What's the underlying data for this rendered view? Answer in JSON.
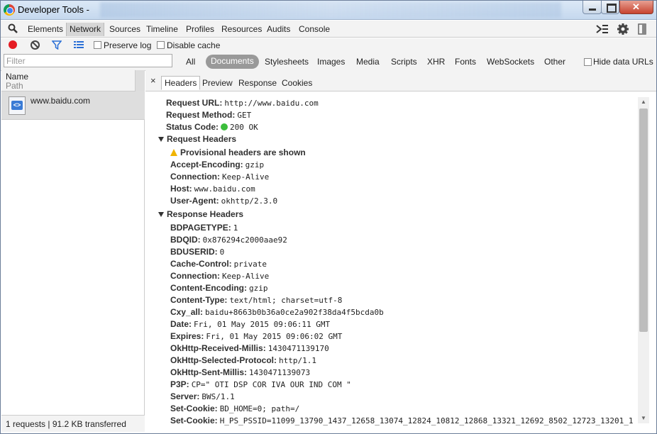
{
  "window": {
    "title": "Developer Tools -"
  },
  "toolbar": {
    "tabs": [
      "Elements",
      "Network",
      "Sources",
      "Timeline",
      "Profiles",
      "Resources",
      "Audits",
      "Console"
    ],
    "active": "Network"
  },
  "controls": {
    "preserve_log": "Preserve log",
    "disable_cache": "Disable cache"
  },
  "filter": {
    "placeholder": "Filter",
    "all": "All",
    "types": [
      "Documents",
      "Stylesheets",
      "Images",
      "Media",
      "Scripts",
      "XHR",
      "Fonts",
      "WebSockets",
      "Other"
    ],
    "active": "Documents",
    "hide_data_urls": "Hide data URLs"
  },
  "request_list": {
    "col_name": "Name",
    "col_path": "Path",
    "items": [
      {
        "name": "www.baidu.com"
      }
    ],
    "status": "1 requests | 91.2 KB transferred"
  },
  "detail": {
    "close": "×",
    "tabs": [
      "Headers",
      "Preview",
      "Response",
      "Cookies"
    ],
    "active": "Headers",
    "general": [
      {
        "k": "Request URL:",
        "v": "http://www.baidu.com"
      },
      {
        "k": "Request Method:",
        "v": "GET"
      },
      {
        "k": "Status Code:",
        "v": "200 OK"
      }
    ],
    "request_headers_title": "Request Headers",
    "provisional": "Provisional headers are shown",
    "request_headers": [
      {
        "k": "Accept-Encoding:",
        "v": "gzip"
      },
      {
        "k": "Connection:",
        "v": "Keep-Alive"
      },
      {
        "k": "Host:",
        "v": "www.baidu.com"
      },
      {
        "k": "User-Agent:",
        "v": "okhttp/2.3.0"
      }
    ],
    "response_headers_title": "Response Headers",
    "response_headers": [
      {
        "k": "BDPAGETYPE:",
        "v": "1"
      },
      {
        "k": "BDQID:",
        "v": "0x876294c2000aae92"
      },
      {
        "k": "BDUSERID:",
        "v": "0"
      },
      {
        "k": "Cache-Control:",
        "v": "private"
      },
      {
        "k": "Connection:",
        "v": "Keep-Alive"
      },
      {
        "k": "Content-Encoding:",
        "v": "gzip"
      },
      {
        "k": "Content-Type:",
        "v": "text/html; charset=utf-8"
      },
      {
        "k": "Cxy_all:",
        "v": "baidu+8663b0b36a0ce2a902f38da4f5bcda0b"
      },
      {
        "k": "Date:",
        "v": "Fri, 01 May 2015 09:06:11 GMT"
      },
      {
        "k": "Expires:",
        "v": "Fri, 01 May 2015 09:06:02 GMT"
      },
      {
        "k": "OkHttp-Received-Millis:",
        "v": "1430471139170"
      },
      {
        "k": "OkHttp-Selected-Protocol:",
        "v": "http/1.1"
      },
      {
        "k": "OkHttp-Sent-Millis:",
        "v": "1430471139073"
      },
      {
        "k": "P3P:",
        "v": "CP=\" OTI DSP COR IVA OUR IND COM \""
      },
      {
        "k": "Server:",
        "v": "BWS/1.1"
      },
      {
        "k": "Set-Cookie:",
        "v": "BD_HOME=0; path=/"
      },
      {
        "k": "Set-Cookie:",
        "v": "H_PS_PSSID=11099_13790_1437_12658_13074_12824_10812_12868_13321_12692_8502_12723_13201_1"
      }
    ]
  },
  "colors": {
    "record": "#e51c23",
    "status_ok": "#3cbe3c",
    "warning": "#f0b400",
    "active_filter": "#999999"
  }
}
